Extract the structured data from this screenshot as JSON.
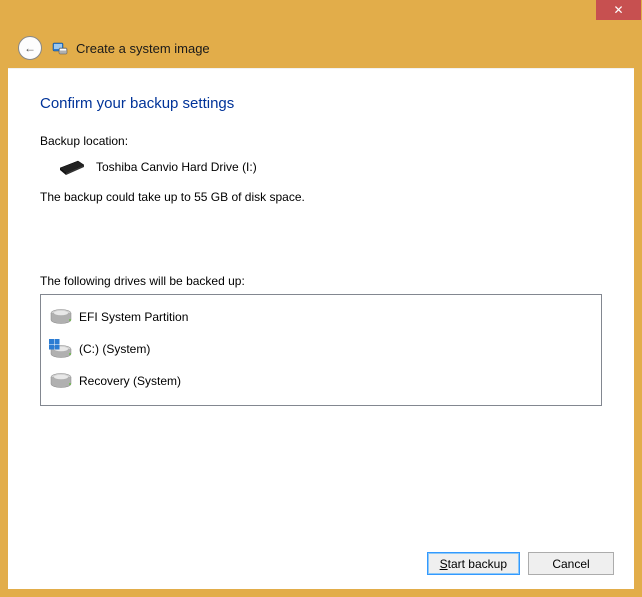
{
  "titlebar": {
    "close_label": "✕"
  },
  "header": {
    "back_glyph": "←",
    "title": "Create a system image"
  },
  "main": {
    "heading": "Confirm your backup settings",
    "backup_location_label": "Backup location:",
    "backup_location_value": "Toshiba Canvio Hard Drive (I:)",
    "disk_space_text": "The backup could take up to 55 GB of disk space.",
    "following_label": "The following drives will be backed up:",
    "drives": [
      {
        "label": "EFI System Partition",
        "icon": "hdd"
      },
      {
        "label": "(C:) (System)",
        "icon": "win"
      },
      {
        "label": "Recovery (System)",
        "icon": "hdd"
      }
    ]
  },
  "buttons": {
    "start_mnemonic": "S",
    "start_rest": "tart backup",
    "cancel": "Cancel"
  }
}
